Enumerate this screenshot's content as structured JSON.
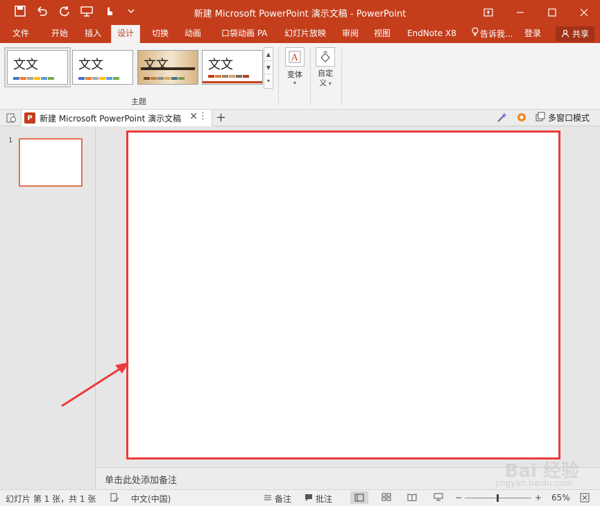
{
  "window": {
    "title": "新建 Microsoft PowerPoint 演示文稿 - PowerPoint",
    "accent": "#c43e1c",
    "controls": [
      "restore-ribbon-icon",
      "minimize-icon",
      "maximize-icon",
      "close-icon"
    ]
  },
  "tabs": [
    {
      "label": "文件"
    },
    {
      "label": "开始"
    },
    {
      "label": "插入"
    },
    {
      "label": "设计",
      "active": true
    },
    {
      "label": "切换"
    },
    {
      "label": "动画"
    },
    {
      "label": "口袋动画 PA"
    },
    {
      "label": "幻灯片放映"
    },
    {
      "label": "审阅"
    },
    {
      "label": "视图"
    },
    {
      "label": "EndNote X8"
    },
    {
      "label": "告诉我..."
    },
    {
      "label": "登录"
    }
  ],
  "share_label": "共享",
  "ribbon": {
    "themes": [
      {
        "label": "文文",
        "colors": [
          "#4472c4",
          "#ed7d31",
          "#a5a5a5",
          "#ffc000",
          "#5b9bd5",
          "#70ad47"
        ]
      },
      {
        "label": "文文",
        "colors": [
          "#4472c4",
          "#ed7d31",
          "#a5a5a5",
          "#ffc000",
          "#5b9bd5",
          "#70ad47"
        ]
      },
      {
        "label": "文文",
        "colors": [
          "#6f4b2a",
          "#c08040",
          "#8c8c8c",
          "#d6a960",
          "#4a6f8a",
          "#7a9a50"
        ]
      },
      {
        "label": "文文",
        "colors": [
          "#c43e1c",
          "#e07a3a",
          "#a08060",
          "#d0a070",
          "#7a6a5a",
          "#b04020"
        ]
      }
    ],
    "group_label": "主题",
    "variant_label": "变体",
    "customize_label": "自定\n义"
  },
  "doc_tab": {
    "badge": "P",
    "title": "新建 Microsoft PowerPoint 演示文稿"
  },
  "thumbs": [
    {
      "number": "1"
    }
  ],
  "notes_placeholder": "单击此处添加备注",
  "status": {
    "slide_info": "幻灯片 第 1 张，共 1 张",
    "language": "中文(中国)",
    "notes_label": "备注",
    "comments_label": "批注",
    "zoom": "65%",
    "multiwindow_label": "多窗口模式"
  },
  "watermark": {
    "main": "Bai 经验",
    "sub": "jingyan.baidu.com"
  }
}
